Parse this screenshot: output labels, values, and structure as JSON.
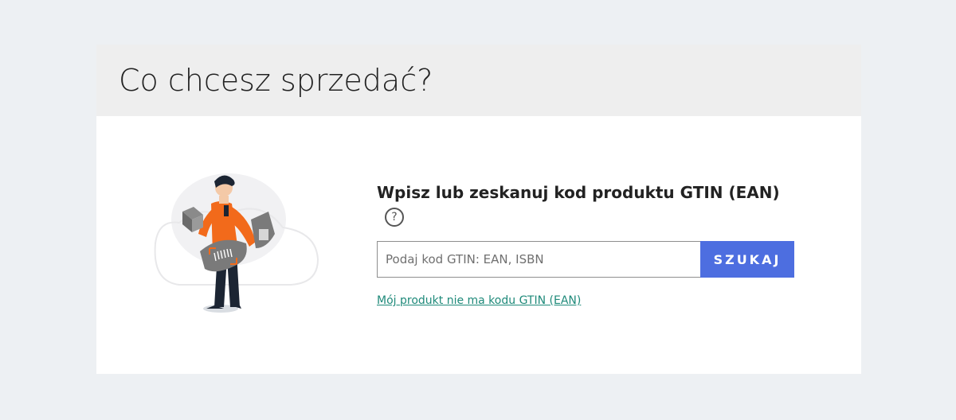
{
  "header": {
    "title": "Co chcesz sprzedać?"
  },
  "form": {
    "heading": "Wpisz lub zeskanuj kod produktu GTIN (EAN)",
    "help_symbol": "?",
    "search_placeholder": "Podaj kod GTIN: EAN, ISBN",
    "search_value": "",
    "search_button_label": "SZUKAJ",
    "no_code_link": "Mój produkt nie ma kodu GTIN (EAN)"
  },
  "colors": {
    "page_background": "#edf0f3",
    "header_background": "#eeeeee",
    "button_blue": "#4d6ee0",
    "link_teal": "#1f8a7a",
    "shirt_orange": "#f26a1b",
    "package_gray": "#7a7a7a"
  },
  "icons": {
    "help": "question-circle-icon",
    "illustration": "person-scanning-products-illustration"
  }
}
